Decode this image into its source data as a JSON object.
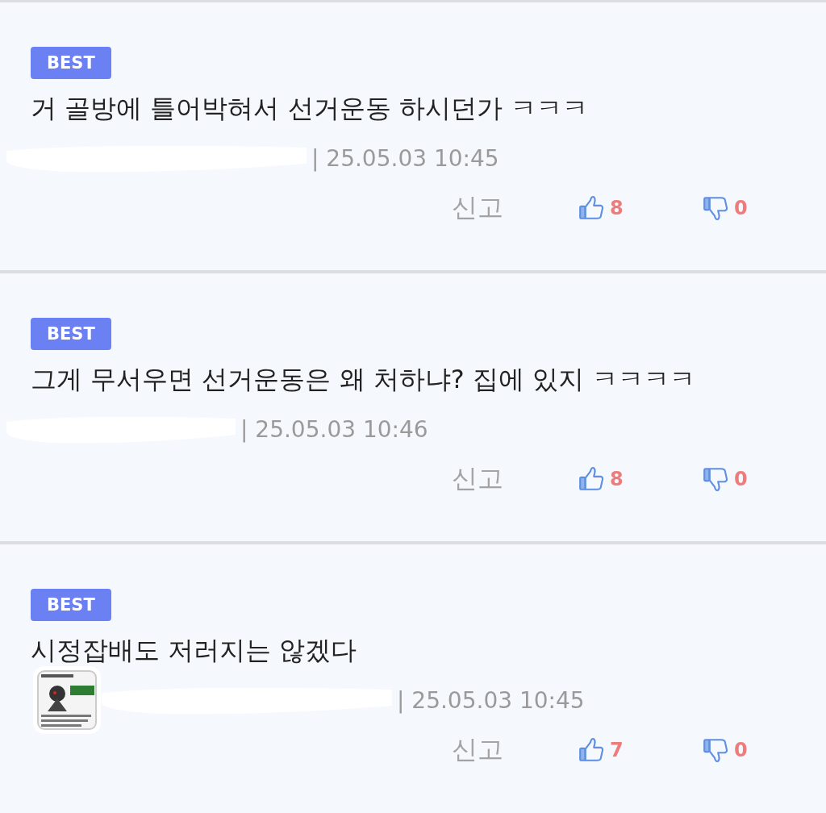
{
  "comments": [
    {
      "badge": "BEST",
      "text": "거 골방에 틀어박혀서 선거운동 하시던가 ㅋㅋㅋ",
      "meta": "| 25.05.03 10:45",
      "report": "신고",
      "likes": "8",
      "dislikes": "0"
    },
    {
      "badge": "BEST",
      "text": "그게 무서우면 선거운동은 왜 처하냐? 집에 있지 ㅋㅋㅋㅋ",
      "meta": "| 25.05.03 10:46",
      "report": "신고",
      "likes": "8",
      "dislikes": "0"
    },
    {
      "badge": "BEST",
      "text": "시정잡배도 저러지는 않겠다",
      "meta": "| 25.05.03 10:45",
      "report": "신고",
      "likes": "7",
      "dislikes": "0"
    }
  ]
}
